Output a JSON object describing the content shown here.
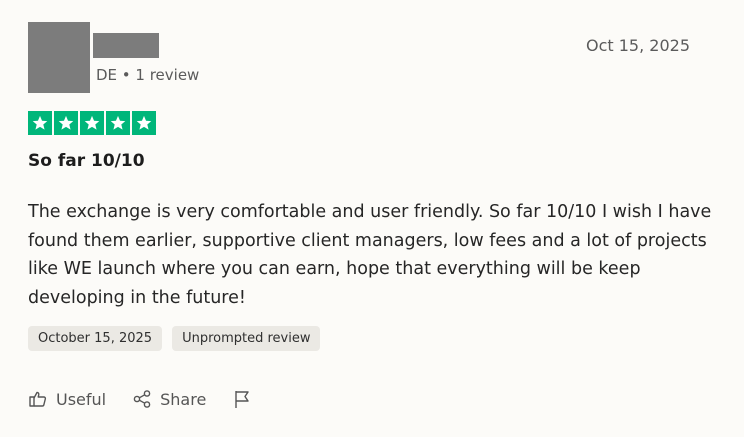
{
  "reviewer": {
    "meta": "DE • 1 review"
  },
  "review": {
    "date": "Oct 15, 2025",
    "rating": 5,
    "title": "So far 10/10",
    "body": "The exchange is very comfortable and user friendly. So far 10/10 I wish I have found them earlier, supportive client managers, low fees and a lot of projects like WE launch where you can earn, hope that everything will be keep developing in the future!",
    "tags": [
      "October 15, 2025",
      "Unprompted review"
    ]
  },
  "actions": {
    "useful_label": "Useful",
    "share_label": "Share"
  },
  "colors": {
    "star_green": "#00b67a",
    "placeholder_gray": "#7c7c7c",
    "tag_background": "#ebe9e4"
  },
  "icons": {
    "useful": "thumbs-up-icon",
    "share": "share-icon",
    "report": "flag-icon"
  }
}
